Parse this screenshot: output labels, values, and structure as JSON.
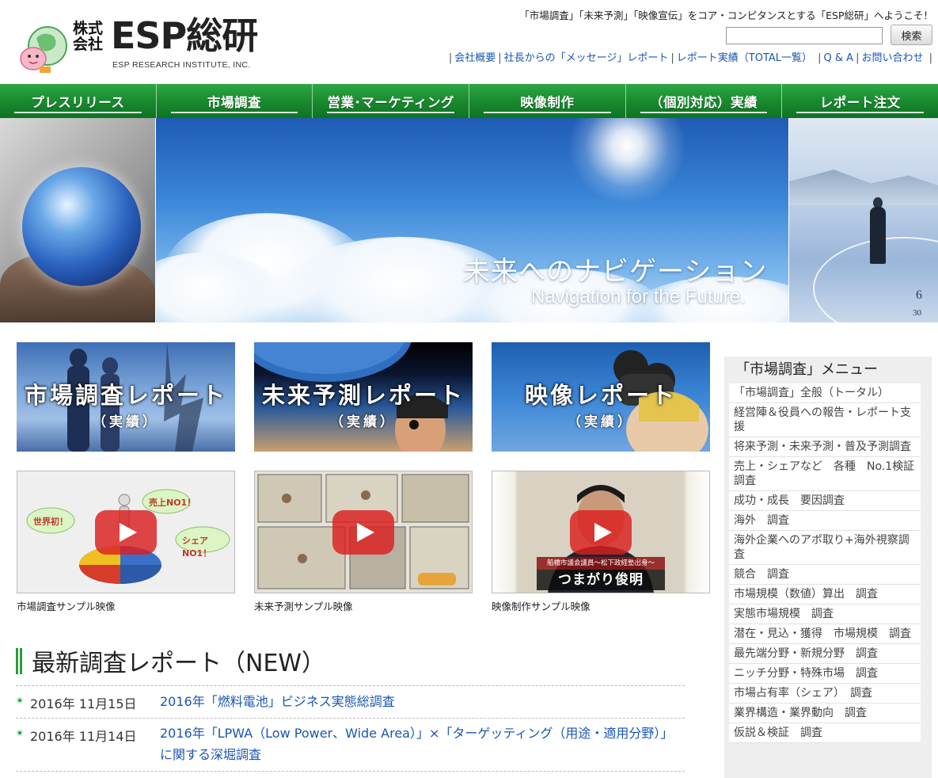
{
  "header": {
    "logo": {
      "kk": "株式会社",
      "mark": "ESP総研",
      "en": "ESP RESEARCH INSTITUTE, INC."
    },
    "welcome": "「市場調査」「未来予測」「映像宣伝」をコア・コンピタンスとする「ESP総研」へようこそ！",
    "search": {
      "placeholder": "",
      "value": "",
      "button_label": "検索"
    },
    "util_nav": [
      {
        "label": "会社概要"
      },
      {
        "label": "社長からの「メッセージ」レポート"
      },
      {
        "label": "レポート実績（TOTAL一覧）"
      },
      {
        "label": "Q & A"
      },
      {
        "label": "お問い合わせ"
      }
    ]
  },
  "global_nav": [
    {
      "label": "プレスリリース"
    },
    {
      "label": "市場調査"
    },
    {
      "label": "営業･マーケティング"
    },
    {
      "label": "映像制作"
    },
    {
      "label": "（個別対応）実績"
    },
    {
      "label": "レポート注文"
    }
  ],
  "hero": {
    "title_jp": "未来へのナビゲーション",
    "title_en": "Navigation for the Future."
  },
  "tiles": [
    {
      "title": "市場調査レポート",
      "sub": "（実績）"
    },
    {
      "title": "未来予測レポート",
      "sub": "（実績）"
    },
    {
      "title": "映像レポート",
      "sub": "（実績）"
    }
  ],
  "videos": [
    {
      "caption": "市場調査サンプル映像",
      "bubbles": [
        "世界初！",
        "売上NO1！",
        "シェアNO1！"
      ]
    },
    {
      "caption": "未来予測サンプル映像"
    },
    {
      "caption": "映像制作サンプル映像",
      "banner": "船橋市議会議員〜松下政経塾出身〜",
      "name": "つまがり俊明"
    }
  ],
  "news": {
    "heading": "最新調査レポート（NEW）",
    "items": [
      {
        "date": "2016年 11月15日",
        "title": "2016年「燃料電池」ビジネス実態総調査"
      },
      {
        "date": "2016年 11月14日",
        "title": "2016年「LPWA（Low Power、Wide Area）」×「ターゲッティング（用途・適用分野）」に関する深堀調査"
      }
    ]
  },
  "sidebar": {
    "title": "「市場調査」メニュー",
    "items": [
      "「市場調査」全般（トータル）",
      "経営陣＆役員への報告・レポート支援",
      "将来予測・未来予測・普及予測調査",
      "売上・シェアなど　各種　No.1検証調査",
      "成功・成長　要因調査",
      "海外　調査",
      "海外企業へのアポ取り+海外視察調査",
      "競合　調査",
      "市場規模（数値）算出　調査",
      "実態市場規模　調査",
      "潜在・見込・獲得　市場規模　調査",
      "最先端分野・新規分野　調査",
      "ニッチ分野・特殊市場　調査",
      "市場占有率（シェア）　調査",
      "業界構造・業界動向　調査",
      "仮説＆検証　調査"
    ]
  },
  "colors": {
    "nav_green": "#1a8a2f",
    "link_blue": "#1a56b3",
    "sidebar_bg": "#eeeeee",
    "play_red": "#dc1e1e"
  }
}
